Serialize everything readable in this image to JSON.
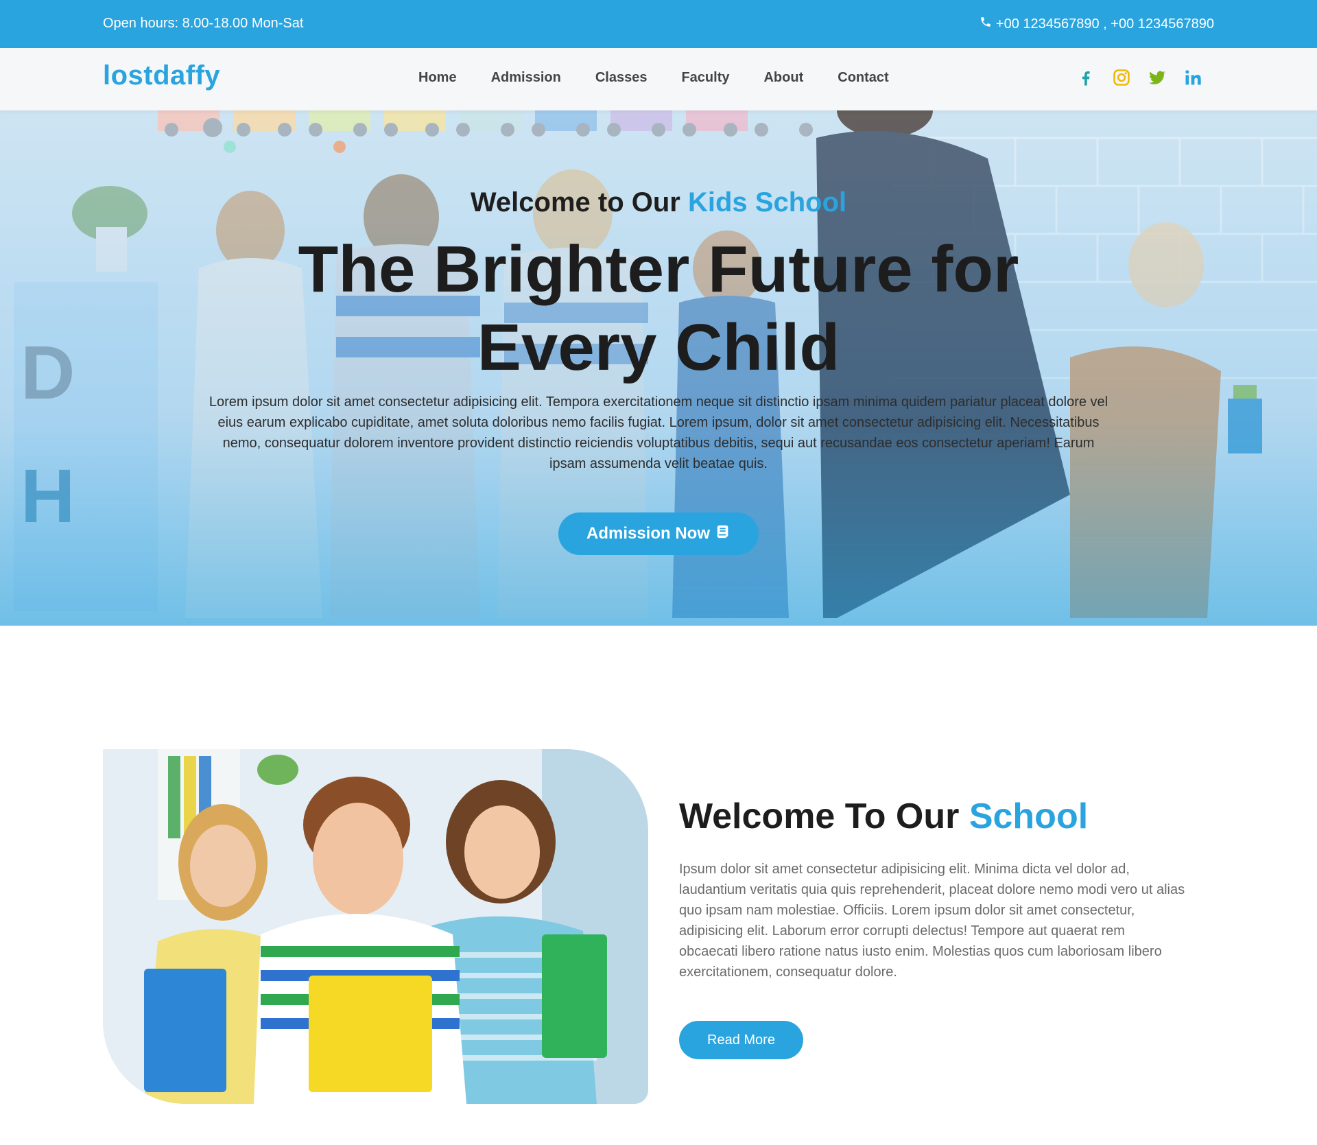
{
  "topbar": {
    "hours": "Open hours: 8.00-18.00 Mon-Sat",
    "phones": "+00 1234567890 , +00 1234567890",
    "color": "#29a4df"
  },
  "nav": {
    "logo": "lostdaffy",
    "items": [
      {
        "label": "Home"
      },
      {
        "label": "Admission"
      },
      {
        "label": "Classes"
      },
      {
        "label": "Faculty"
      },
      {
        "label": "About"
      },
      {
        "label": "Contact"
      }
    ],
    "social": [
      {
        "icon": "facebook-icon",
        "color": "#1aa3a8"
      },
      {
        "icon": "instagram-icon",
        "color": "#f2b705"
      },
      {
        "icon": "twitter-icon",
        "color": "#7cb518"
      },
      {
        "icon": "linkedin-icon",
        "color": "#29a4df"
      }
    ]
  },
  "hero": {
    "subtitle_prefix": "Welcome to Our",
    "subtitle_accent": "Kids School",
    "title": "The Brighter Future for Every Child",
    "lead": "Lorem ipsum dolor sit amet consectetur adipisicing elit. Tempora exercitationem neque sit distinctio ipsam minima quidem pariatur placeat dolore vel eius earum explicabo cupiditate, amet soluta doloribus nemo facilis fugiat. Lorem ipsum, dolor sit amet consectetur adipisicing elit. Necessitatibus nemo, consequatur dolorem inventore provident distinctio reiciendis voluptatibus debitis, sequi aut recusandae eos consectetur aperiam! Earum ipsam assumenda velit beatae quis.",
    "button": "Admission Now",
    "button_icon": "book-icon"
  },
  "welcome": {
    "title_prefix": "Welcome To Our",
    "title_accent": "School",
    "text": "Ipsum dolor sit amet consectetur adipisicing elit. Minima dicta vel dolor ad, laudantium veritatis quia quis reprehenderit, placeat dolore nemo modi vero ut alias quo ipsam nam molestiae. Officiis. Lorem ipsum dolor sit amet consectetur, adipisicing elit. Laborum error corrupti delectus! Tempore aut quaerat rem obcaecati libero ratione natus iusto enim. Molestias quos cum laboriosam libero exercitationem, consequatur dolore.",
    "button": "Read More"
  },
  "colors": {
    "accent": "#29a4df",
    "heading": "#1d1d1d",
    "body_text": "#6a6a6a"
  }
}
